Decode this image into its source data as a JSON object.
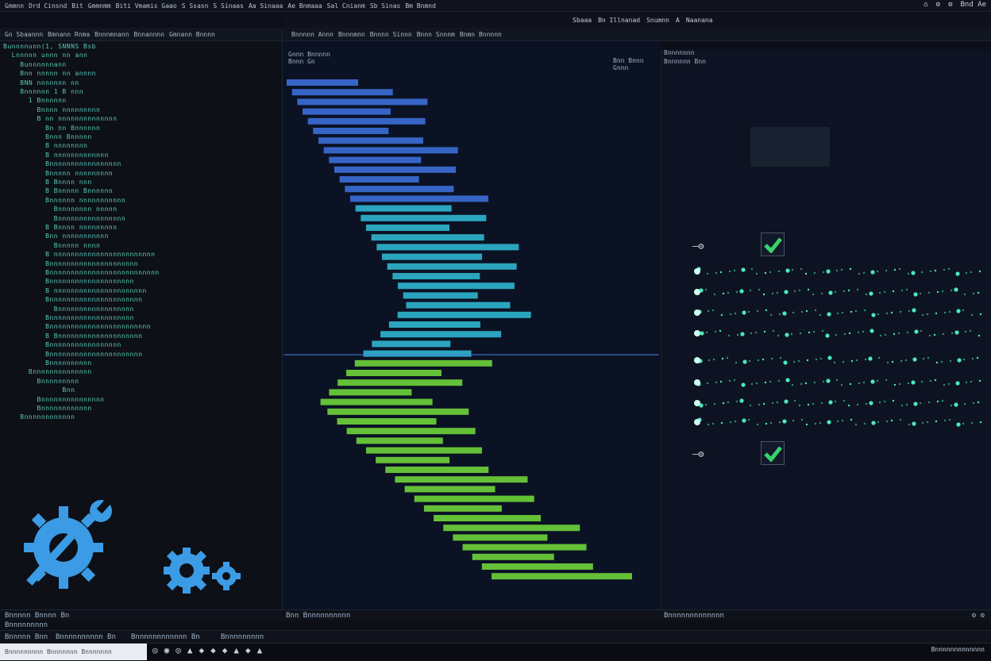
{
  "menubar": {
    "items": [
      "Gmmnn",
      "Drd Cinsnd",
      "Bit",
      "Gmmnmm",
      "Biti Vmamis Gaao",
      "S Ssasn",
      "S Sinaas",
      "Aa Sinaaa",
      "Ae Bnmaaa",
      "Sal Cnianm",
      "Sb Sinas",
      "Bm Bnmnd"
    ],
    "right_icons": [
      "⌂",
      "⚙",
      "⚙",
      "Bnd Ae"
    ]
  },
  "tabbar": {
    "tabs": [
      "Sbaaa",
      "Bn Illnanad",
      "Snumnn",
      "A",
      "Naanana"
    ]
  },
  "left_toolbar": {
    "items": [
      "Gn Sbaannn",
      "Bmnann Rnma",
      "Bnnnmnann",
      "Bnnannnn",
      "Gmnann Bnnnn"
    ]
  },
  "mid_toolbar": {
    "items": [
      "Bnnnnn Annn",
      "Bnnnmnn",
      "Bnnnn Sinnn",
      "Bnnn Snnnm",
      "Bnmn Bnnnnn"
    ]
  },
  "mid_header": {
    "title": "Gnnn Bnnnnn",
    "sub": "Bnnn Gn",
    "right": "Bnn Bnnn Gnnn"
  },
  "right_header": {
    "title": "Bnnnnnnn",
    "sub": "Bnnnnnn Bnn"
  },
  "code_lines": [
    "Bunnnnunn(1, SNNNS Bsb",
    "  Lnnnnn unnn nn ann",
    "    Bunnnnnnann",
    "    Bnn nnnnn nn annnn",
    "    BNN nnnnnnn nn",
    "    Bnnnnnn 1 B nnn",
    "      1 Bnnnnnn",
    "        Bnnnn nnnnnnnnn",
    "        B nn nnnnnnnnnnnnnn",
    "          Bn nn Bnnnnnn",
    "          Bnnn Bnnnnn",
    "          B nnnnnnnn",
    "          B nnnnnnnnnnnnn",
    "          Bnnnnnnnnnnnnnnnnn",
    "          Bnnnnn nnnnnnnnn",
    "          B Bnnnn nnn",
    "          B Bnnnnn Bnnnnnn",
    "          Bnnnnnn nnnnnnnnnnn",
    "            Bnnnnnnnn nnnnn",
    "            Bnnnnnnnnnnnnnnnn",
    "          B Bnnnn nnnnnnnnn",
    "          Bnn nnnnnnnnnnn",
    "            Bnnnnn nnnn",
    "          B nnnnnnnnnnnnnnnnnnnnnnnn",
    "          Bnnnnnnnnnnnnnnnnnnnnn",
    "          Bnnnnnnnnnnnnnnnnnnnnnnnnnn",
    "          Bnnnnnnnnnnnnnnnnnnnn",
    "          B nnnnnnnnnnnnnnnnnnnnnn",
    "          Bnnnnnnnnnnnnnnnnnnnnnn",
    "            Bnnnnnnnnnnnnnnnnnn",
    "          Bnnnnnnnnnnnnnnnnnnnn",
    "          Bnnnnnnnnnnnnnnnnnnnnnnnn",
    "          B Bnnnnnnnnnnnnnnnnnnnn",
    "          Bnnnnnnnnnnnnnnnnn",
    "          Bnnnnnnnnnnnnnnnnnnnnnn",
    "          Bnnnnnnnnnn",
    "      Bnnnnnnnnnnnnnn",
    "        Bnnnnnnnnn",
    "              Bnn",
    "        Bnnnnnnnnnnnnnnn",
    "        Bnnnnnnnnnnnn",
    "    Bnnnnnnnnnnnn"
  ],
  "status1": {
    "left": "Bnnnnn Bnnnn Bn",
    "mid_left": "Bnn Bnnnnnnnnnn",
    "mid_right": "Bnnnnnnnnnnnnn",
    "right": "⚙ ⚙"
  },
  "status2": {
    "left": "Bnnnnnnnnn"
  },
  "status3": {
    "items": [
      "Bnnnnn Bnn",
      "Bnnnnnnnnnn Bn",
      "Bnnnnnnnnnnnn Bn",
      "Bnnnnnnnnn"
    ]
  },
  "taskbar": {
    "search": "Bnnnnnnnnn Bnnnnnnn Bnnnnnnn",
    "tray": "Bnnnnnnnnnnnnn",
    "icons": [
      "◎",
      "◉",
      "◎",
      "▲",
      "◆",
      "◆",
      "◆",
      "▲",
      "◆",
      "▲"
    ]
  },
  "right_panel": {
    "rows": 8,
    "checks": 2
  },
  "colors": {
    "code_text": "#58c7b8",
    "bar_blue": "#3b6fd8",
    "bar_cyan": "#2fb6cf",
    "bar_green": "#6ed43a",
    "gear": "#3b9be5",
    "check_green": "#37d36b",
    "particle": "#4ff3c8"
  }
}
